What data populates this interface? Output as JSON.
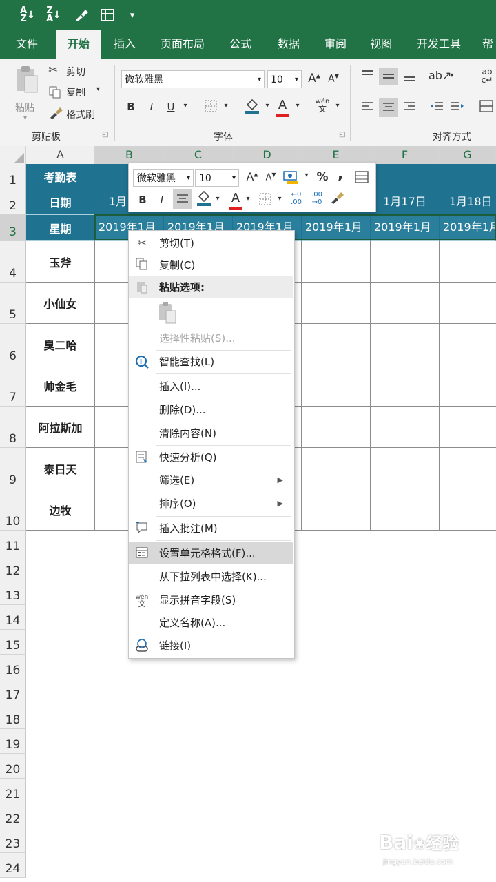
{
  "qat": {
    "sort_asc": "A↓Z",
    "sort_desc": "Z↓A",
    "dropdown": "▾"
  },
  "tabs": [
    "文件",
    "开始",
    "插入",
    "页面布局",
    "公式",
    "数据",
    "审阅",
    "视图",
    "开发工具",
    "帮"
  ],
  "active_tab_index": 1,
  "ribbon": {
    "paste_label": "粘贴",
    "cut_label": "剪切",
    "copy_label": "复制",
    "format_painter_label": "格式刷",
    "clipboard_group": "剪贴板",
    "font_name": "微软雅黑",
    "font_size": "10",
    "font_group": "字体",
    "align_group": "对齐方式",
    "bold": "B",
    "italic": "I",
    "underline": "U",
    "grow_font": "A",
    "shrink_font": "A",
    "phonetic_top": "wén",
    "phonetic_bottom": "文"
  },
  "columns": [
    "A",
    "B",
    "C",
    "D",
    "E",
    "F",
    "G"
  ],
  "rows": [
    "1",
    "2",
    "3",
    "4",
    "5",
    "6",
    "7",
    "8",
    "9",
    "10",
    "11",
    "12",
    "13",
    "14",
    "15",
    "16",
    "17",
    "18",
    "19",
    "20",
    "21",
    "22",
    "23",
    "24"
  ],
  "sheet": {
    "a1": "考勤表",
    "a2": "日期",
    "a3": "星期",
    "b2": "1月",
    "f2": "1月17日",
    "g2": "1月18日",
    "row3_value": "2019年1月",
    "names": [
      "玉斧",
      "小仙女",
      "臭二哈",
      "帅金毛",
      "阿拉斯加",
      "泰日天",
      "边牧"
    ]
  },
  "mini_toolbar": {
    "font_name": "微软雅黑",
    "font_size": "10",
    "grow": "A",
    "shrink": "A",
    "percent": "%",
    "comma": ",",
    "bold": "B",
    "italic": "I",
    "font_color": "A",
    "inc_decimal_top": "←0",
    "inc_decimal_bottom": ".00",
    "dec_decimal_top": ".00",
    "dec_decimal_bottom": "→0"
  },
  "context_menu": {
    "cut": "剪切(T)",
    "copy": "复制(C)",
    "paste_options": "粘贴选项:",
    "paste_special": "选择性粘贴(S)...",
    "smart_lookup": "智能查找(L)",
    "insert": "插入(I)...",
    "delete": "删除(D)...",
    "clear_contents": "清除内容(N)",
    "quick_analysis": "快速分析(Q)",
    "filter": "筛选(E)",
    "sort": "排序(O)",
    "insert_comment": "插入批注(M)",
    "format_cells": "设置单元格格式(F)...",
    "pick_from_list": "从下拉列表中选择(K)...",
    "show_phonetic": "显示拼音字段(S)",
    "define_name": "定义名称(A)...",
    "link": "链接(I)"
  },
  "watermark": {
    "brand": "Bai",
    "brand2": "经验",
    "url": "jingyan.baidu.com"
  },
  "colors": {
    "excel_green": "#217346",
    "header_teal": "#1f7391"
  }
}
